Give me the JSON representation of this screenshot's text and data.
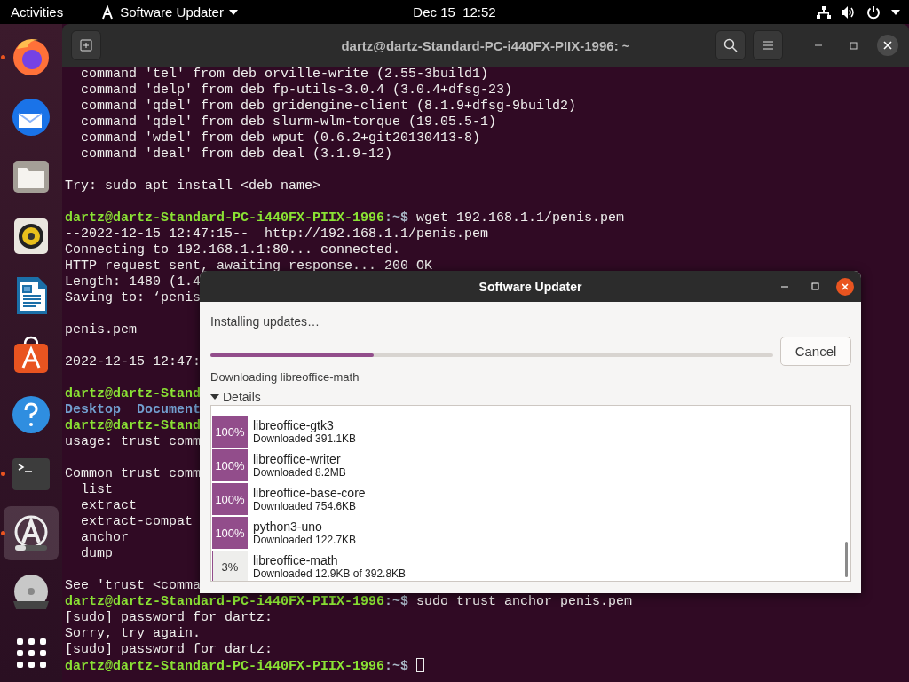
{
  "top_bar": {
    "activities": "Activities",
    "app_menu": "Software Updater",
    "clock": "Dec 15  12:52"
  },
  "dock": {
    "items": [
      {
        "kind": "firefox",
        "running": true,
        "selected": false
      },
      {
        "kind": "mail",
        "running": false,
        "selected": false
      },
      {
        "kind": "files",
        "running": false,
        "selected": false
      },
      {
        "kind": "music",
        "running": false,
        "selected": false
      },
      {
        "kind": "writer",
        "running": false,
        "selected": false
      },
      {
        "kind": "store",
        "running": false,
        "selected": false
      },
      {
        "kind": "help",
        "running": false,
        "selected": false
      },
      {
        "kind": "terminal",
        "running": true,
        "selected": false
      },
      {
        "kind": "updater",
        "running": true,
        "selected": true
      },
      {
        "kind": "dvd",
        "running": false,
        "selected": false
      },
      {
        "kind": "apps",
        "running": false,
        "selected": false
      }
    ]
  },
  "terminal": {
    "title": "dartz@dartz-Standard-PC-i440FX-PIIX-1996: ~",
    "lines": [
      {
        "kind": "output",
        "text": "  command 'tel' from deb orville-write (2.55-3build1)"
      },
      {
        "kind": "output",
        "text": "  command 'delp' from deb fp-utils-3.0.4 (3.0.4+dfsg-23)"
      },
      {
        "kind": "output",
        "text": "  command 'qdel' from deb gridengine-client (8.1.9+dfsg-9build2)"
      },
      {
        "kind": "output",
        "text": "  command 'qdel' from deb slurm-wlm-torque (19.05.5-1)"
      },
      {
        "kind": "output",
        "text": "  command 'wdel' from deb wput (0.6.2+git20130413-8)"
      },
      {
        "kind": "output",
        "text": "  command 'deal' from deb deal (3.1.9-12)"
      },
      {
        "kind": "blank"
      },
      {
        "kind": "output",
        "text": "Try: sudo apt install <deb name>"
      },
      {
        "kind": "blank"
      },
      {
        "kind": "prompt",
        "user": "dartz@dartz-Standard-PC-i440FX-PIIX-1996",
        "path": ":~$",
        "command": "wget 192.168.1.1/penis.pem"
      },
      {
        "kind": "output",
        "text": "--2022-12-15 12:47:15--  http://192.168.1.1/penis.pem"
      },
      {
        "kind": "output",
        "text": "Connecting to 192.168.1.1:80... connected."
      },
      {
        "kind": "output",
        "text": "HTTP request sent, awaiting response... 200 OK"
      },
      {
        "kind": "output",
        "text": "Length: 1480 (1.4"
      },
      {
        "kind": "output",
        "text": "Saving to: ‘penis"
      },
      {
        "kind": "blank"
      },
      {
        "kind": "output",
        "text": "penis.pem"
      },
      {
        "kind": "blank"
      },
      {
        "kind": "output",
        "text": "2022-12-15 12:47:"
      },
      {
        "kind": "blank"
      },
      {
        "kind": "prompt",
        "user": "dartz@dartz-Stand"
      },
      {
        "kind": "listing",
        "entries": [
          "Desktop",
          "Document"
        ]
      },
      {
        "kind": "prompt",
        "user": "dartz@dartz-Stand"
      },
      {
        "kind": "output",
        "text": "usage: trust comm"
      },
      {
        "kind": "blank"
      },
      {
        "kind": "output",
        "text": "Common trust comm"
      },
      {
        "kind": "output",
        "text": "  list"
      },
      {
        "kind": "output",
        "text": "  extract"
      },
      {
        "kind": "output",
        "text": "  extract-compat"
      },
      {
        "kind": "output",
        "text": "  anchor"
      },
      {
        "kind": "output",
        "text": "  dump"
      },
      {
        "kind": "blank"
      },
      {
        "kind": "output",
        "text": "See 'trust <comma"
      },
      {
        "kind": "prompt",
        "user": "dartz@dartz-Standard-PC-i440FX-PIIX-1996",
        "path": ":~$",
        "command": "sudo trust anchor penis.pem"
      },
      {
        "kind": "output",
        "text": "[sudo] password for dartz:"
      },
      {
        "kind": "output",
        "text": "Sorry, try again."
      },
      {
        "kind": "output",
        "text": "[sudo] password for dartz:"
      },
      {
        "kind": "prompt",
        "user": "dartz@dartz-Standard-PC-i440FX-PIIX-1996",
        "path": ":~$",
        "cursor": true
      }
    ]
  },
  "updater": {
    "title": "Software Updater",
    "heading": "Installing updates…",
    "progress": {
      "level": 0.29
    },
    "cancel": "Cancel",
    "status": "Downloading libreoffice-math",
    "details": {
      "label": "Details",
      "expanded": true
    },
    "packages": [
      {
        "percent": "100%",
        "level": 1,
        "name": "libreoffice-gtk3",
        "status": "Downloaded 391.1KB"
      },
      {
        "percent": "100%",
        "level": 1,
        "name": "libreoffice-writer",
        "status": "Downloaded 8.2MB"
      },
      {
        "percent": "100%",
        "level": 1,
        "name": "libreoffice-base-core",
        "status": "Downloaded 754.6KB"
      },
      {
        "percent": "100%",
        "level": 1,
        "name": "python3-uno",
        "status": "Downloaded 122.7KB"
      },
      {
        "percent": "3%",
        "level": 0.03,
        "name": "libreoffice-math",
        "status": "Downloaded 12.9KB of 392.8KB"
      }
    ]
  }
}
